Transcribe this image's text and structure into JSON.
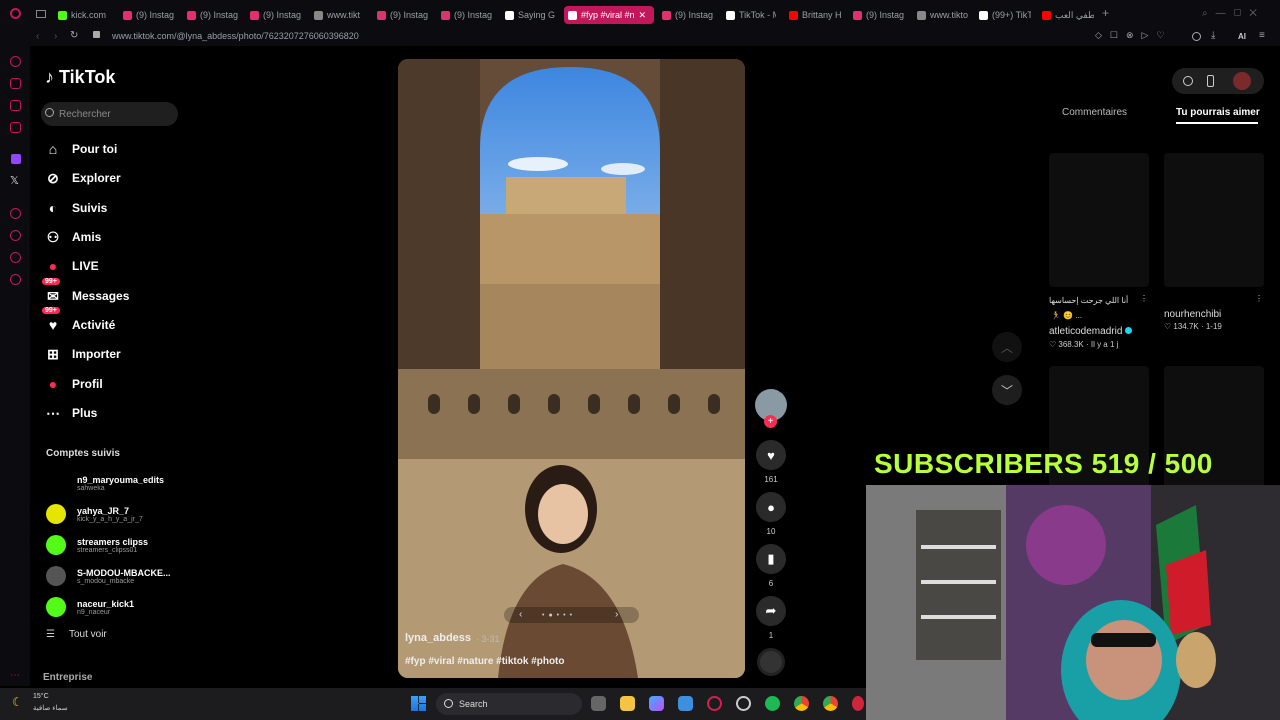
{
  "browser": {
    "tabs": [
      {
        "label": "kick.com",
        "active": false,
        "color": "#53fc18"
      },
      {
        "label": "(9) Instag",
        "active": false,
        "color": "#e1306c"
      },
      {
        "label": "(9) Instag",
        "active": false,
        "color": "#e1306c"
      },
      {
        "label": "(9) Instag",
        "active": false,
        "color": "#e1306c"
      },
      {
        "label": "www.tikt",
        "active": false,
        "color": "#888888"
      },
      {
        "label": "(9) Instag",
        "active": false,
        "color": "#e1306c"
      },
      {
        "label": "(9) Instag",
        "active": false,
        "color": "#e1306c"
      },
      {
        "label": "Saying G",
        "active": false,
        "color": "#ffffff"
      },
      {
        "label": "#fyp #viral #n",
        "active": true,
        "color": "#ffffff"
      },
      {
        "label": "(9) Instag",
        "active": false,
        "color": "#e1306c"
      },
      {
        "label": "TikTok - M",
        "active": false,
        "color": "#ffffff"
      },
      {
        "label": "Brittany H",
        "active": false,
        "color": "#ff0000"
      },
      {
        "label": "(9) Instag",
        "active": false,
        "color": "#e1306c"
      },
      {
        "label": "www.tikto",
        "active": false,
        "color": "#888888"
      },
      {
        "label": "(99+) TikT",
        "active": false,
        "color": "#ffffff"
      },
      {
        "label": "لطفي العب",
        "active": false,
        "color": "#ff0000"
      }
    ],
    "url": "www.tiktok.com/@lyna_abdess/photo/7623207276060396820",
    "ai_label": "AI"
  },
  "sidebar": {
    "logo": "TikTok",
    "search_placeholder": "Rechercher",
    "nav": [
      {
        "label": "Pour toi",
        "icon": "home-icon",
        "glyph": "⌂"
      },
      {
        "label": "Explorer",
        "icon": "compass-icon",
        "glyph": "⊘"
      },
      {
        "label": "Suivis",
        "icon": "following-icon",
        "glyph": "◐"
      },
      {
        "label": "Amis",
        "icon": "friends-icon",
        "glyph": "⚇"
      },
      {
        "label": "LIVE",
        "icon": "live-icon",
        "glyph": "●"
      },
      {
        "label": "Messages",
        "icon": "messages-icon",
        "glyph": "✉",
        "badge": "99+"
      },
      {
        "label": "Activité",
        "icon": "activity-icon",
        "glyph": "♥",
        "badge": "99+"
      },
      {
        "label": "Importer",
        "icon": "upload-icon",
        "glyph": "⊞"
      },
      {
        "label": "Profil",
        "icon": "profile-icon",
        "glyph": "●"
      },
      {
        "label": "Plus",
        "icon": "more-icon",
        "glyph": "⋯"
      }
    ],
    "following_title": "Comptes suivis",
    "following": [
      {
        "name": "n9_maryouma_edits",
        "sub": "sahweka",
        "color": "#000000"
      },
      {
        "name": "yahya_JR_7",
        "sub": "kick_y_a_h_y_a_jr_7",
        "color": "#e5e500"
      },
      {
        "name": "streamers clipss",
        "sub": "streamers_clipss01",
        "color": "#53fc18"
      },
      {
        "name": "S-MODOU-MBACKE...",
        "sub": "s_modou_mbacke",
        "color": "#555555"
      },
      {
        "name": "naceur_kick1",
        "sub": "n9_naceur",
        "color": "#53fc18"
      }
    ],
    "see_all": "Tout voir",
    "enterprise": "Entreprise"
  },
  "post": {
    "author": "lyna_abdess",
    "date": "· 3-31",
    "tags": "#fyp #viral #nature  #tiktok #photo",
    "actions": [
      {
        "name": "like",
        "icon": "heart-icon",
        "glyph": "♥",
        "count": "161"
      },
      {
        "name": "comment",
        "icon": "comment-icon",
        "glyph": "●",
        "count": "10"
      },
      {
        "name": "bookmark",
        "icon": "bookmark-icon",
        "glyph": "▮",
        "count": "6"
      },
      {
        "name": "share",
        "icon": "share-icon",
        "glyph": "➦",
        "count": "1"
      }
    ]
  },
  "right_panel": {
    "tab_comments": "Commentaires",
    "tab_suggestions": "Tu pourrais aimer",
    "videos": [
      {
        "title": "أنا اللي جرحت إحساسها",
        "emoji": "🏃 😊 ...",
        "author": "atleticodemadrid",
        "stats": "♡ 368.3K · Il y a 1 j"
      },
      {
        "title": "",
        "emoji": "",
        "author": "nourhenchibi",
        "stats": "♡ 134.7K · 1-19"
      }
    ]
  },
  "overlay": {
    "subscribers": "SUBSCRIBERS 519 / 500"
  },
  "taskbar": {
    "temperature": "15°C",
    "weather": "سماء صافية",
    "search_label": "Search"
  }
}
